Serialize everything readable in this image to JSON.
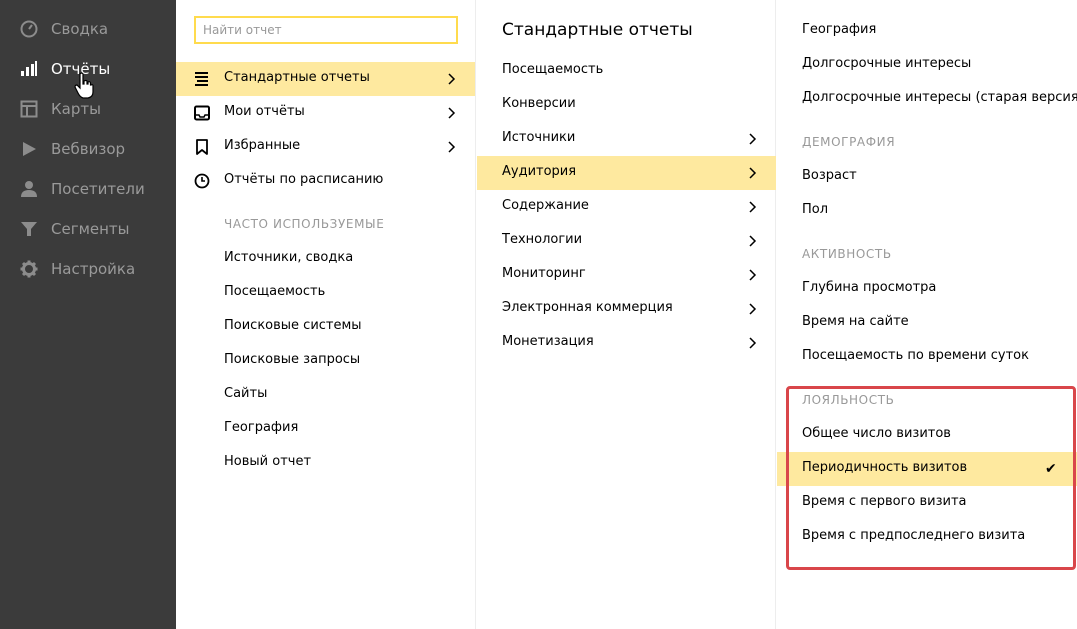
{
  "sidebar": {
    "items": [
      {
        "label": "Сводка",
        "icon": "gauge-icon",
        "active": false
      },
      {
        "label": "Отчёты",
        "icon": "bar-chart-icon",
        "active": true
      },
      {
        "label": "Карты",
        "icon": "layout-map-icon",
        "active": false
      },
      {
        "label": "Вебвизор",
        "icon": "play-icon",
        "active": false
      },
      {
        "label": "Посетители",
        "icon": "user-icon",
        "active": false
      },
      {
        "label": "Сегменты",
        "icon": "filter-icon",
        "active": false
      },
      {
        "label": "Настройка",
        "icon": "gear-icon",
        "active": false
      }
    ]
  },
  "search": {
    "placeholder": "Найти отчет"
  },
  "reports_menu": {
    "items": [
      {
        "label": "Стандартные отчеты",
        "icon": "list-icon",
        "has_submenu": true,
        "selected": true
      },
      {
        "label": "Мои отчёты",
        "icon": "inbox-icon",
        "has_submenu": true,
        "selected": false
      },
      {
        "label": "Избранные",
        "icon": "bookmark-icon",
        "has_submenu": true,
        "selected": false
      },
      {
        "label": "Отчёты по расписанию",
        "icon": "clock-icon",
        "has_submenu": false,
        "selected": false
      }
    ],
    "frequent_title": "ЧАСТО ИСПОЛЬЗУЕМЫЕ",
    "frequent": [
      "Источники, сводка",
      "Посещаемость",
      "Поисковые системы",
      "Поисковые запросы",
      "Сайты",
      "География",
      "Новый отчет"
    ]
  },
  "standard_reports": {
    "title": "Стандартные отчеты",
    "items": [
      {
        "label": "Посещаемость",
        "has_submenu": false
      },
      {
        "label": "Конверсии",
        "has_submenu": false
      },
      {
        "label": "Источники",
        "has_submenu": true
      },
      {
        "label": "Аудитория",
        "has_submenu": true,
        "selected": true
      },
      {
        "label": "Содержание",
        "has_submenu": true
      },
      {
        "label": "Технологии",
        "has_submenu": true
      },
      {
        "label": "Мониторинг",
        "has_submenu": true
      },
      {
        "label": "Электронная коммерция",
        "has_submenu": true
      },
      {
        "label": "Монетизация",
        "has_submenu": true
      }
    ]
  },
  "audience": {
    "top_items": [
      "География",
      "Долгосрочные интересы",
      "Долгосрочные интересы (старая версия)"
    ],
    "demography_title": "ДЕМОГРАФИЯ",
    "demography": [
      "Возраст",
      "Пол"
    ],
    "activity_title": "АКТИВНОСТЬ",
    "activity": [
      "Глубина просмотра",
      "Время на сайте",
      "Посещаемость по времени суток"
    ],
    "loyalty_title": "ЛОЯЛЬНОСТЬ",
    "loyalty": [
      {
        "label": "Общее число визитов",
        "selected": false
      },
      {
        "label": "Периодичность визитов",
        "selected": true
      },
      {
        "label": "Время с первого визита",
        "selected": false
      },
      {
        "label": "Время с предпоследнего визита",
        "selected": false
      }
    ]
  },
  "colors": {
    "sidebar_bg": "#3b3b3b",
    "highlight": "#fee99f",
    "search_border": "#ffdb4d",
    "annotation_red": "#d9464a"
  }
}
